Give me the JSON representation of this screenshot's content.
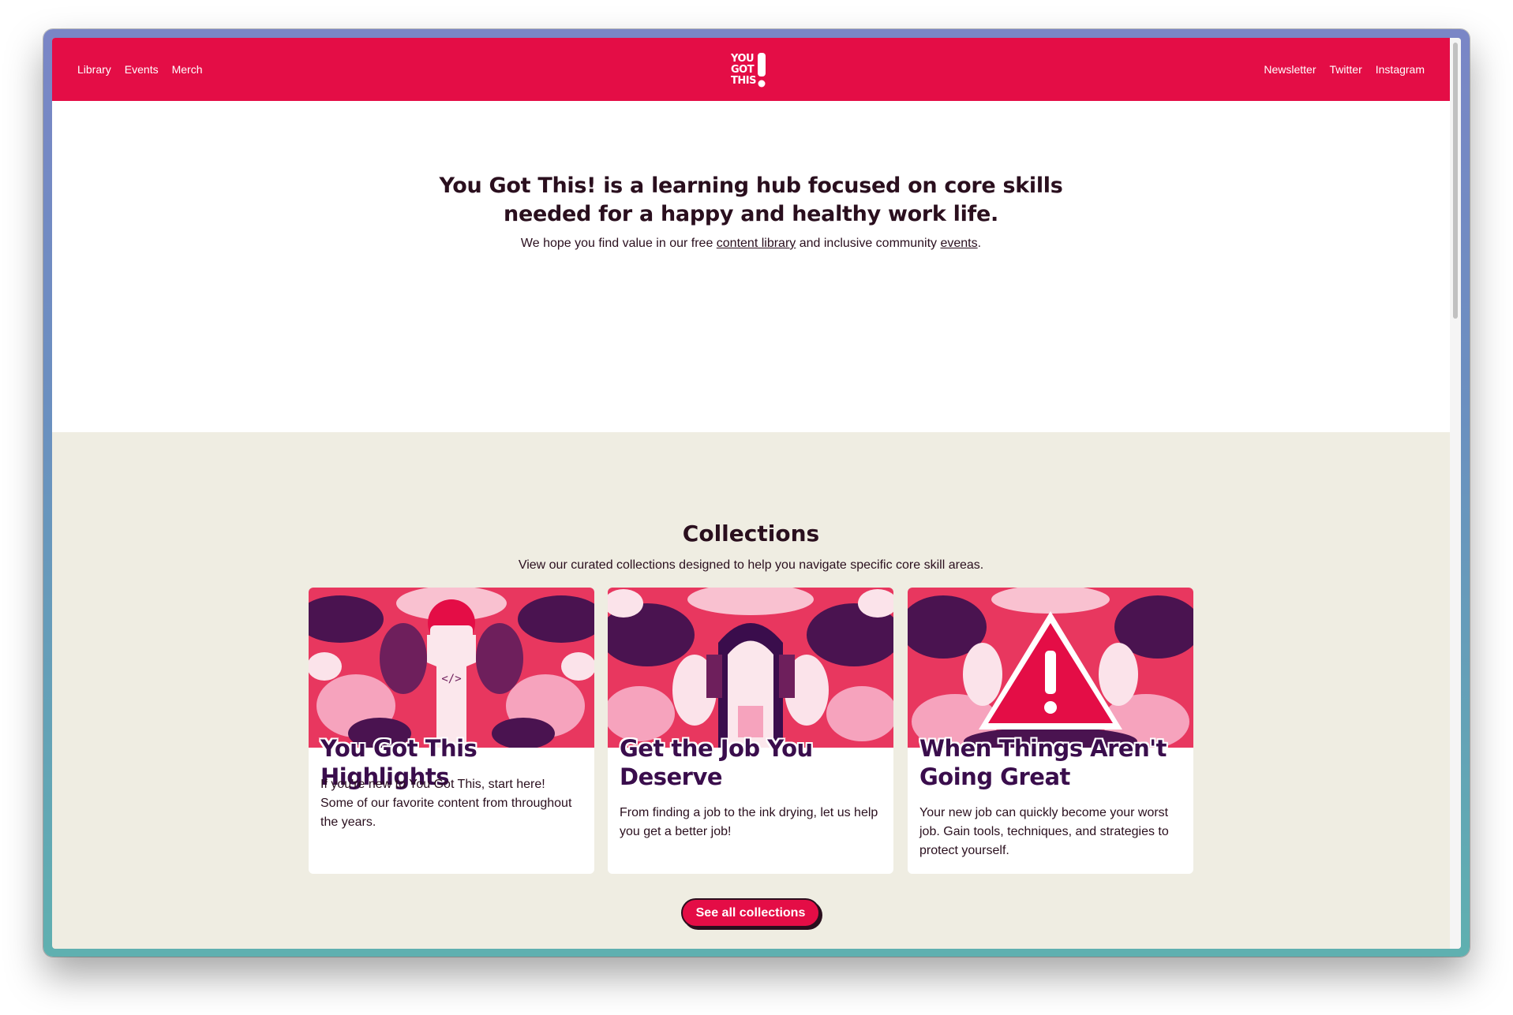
{
  "nav": {
    "left_links": [
      "Library",
      "Events",
      "Merch"
    ],
    "right_links": [
      "Newsletter",
      "Twitter",
      "Instagram"
    ],
    "logo_lines": [
      "YOU",
      "GOT",
      "THIS"
    ],
    "logo_bang": "!"
  },
  "hero": {
    "title_line1": "You Got This! is a learning hub focused on core skills",
    "title_line2": "needed for a happy and healthy work life.",
    "sub_before": "We hope you find value in our free ",
    "sub_link1": "content library",
    "sub_middle": " and inclusive community ",
    "sub_link2": "events",
    "sub_after": "."
  },
  "collections": {
    "title": "Collections",
    "subtitle": "View our curated collections designed to help you navigate specific core skill areas.",
    "cards": [
      {
        "title": "You Got This Highlights",
        "description": "If you're new to You Got This, start here! Some of our favorite content from throughout the years.",
        "image_icon": "raised-fist-icon"
      },
      {
        "title": "Get the Job You Deserve",
        "description": "From finding a job to the ink drying, let us help you get a better job!",
        "image_icon": "door-icon"
      },
      {
        "title": "When Things Aren't Going Great",
        "description": "Your new job can quickly become your worst job. Gain tools, techniques, and strategies to protect yourself.",
        "image_icon": "warning-icon"
      }
    ],
    "cta_label": "See all collections"
  },
  "colors": {
    "brand": "#e40d46",
    "ink": "#2a0f1e",
    "card_title": "#3a0d4c",
    "section_bg": "#efede2"
  }
}
